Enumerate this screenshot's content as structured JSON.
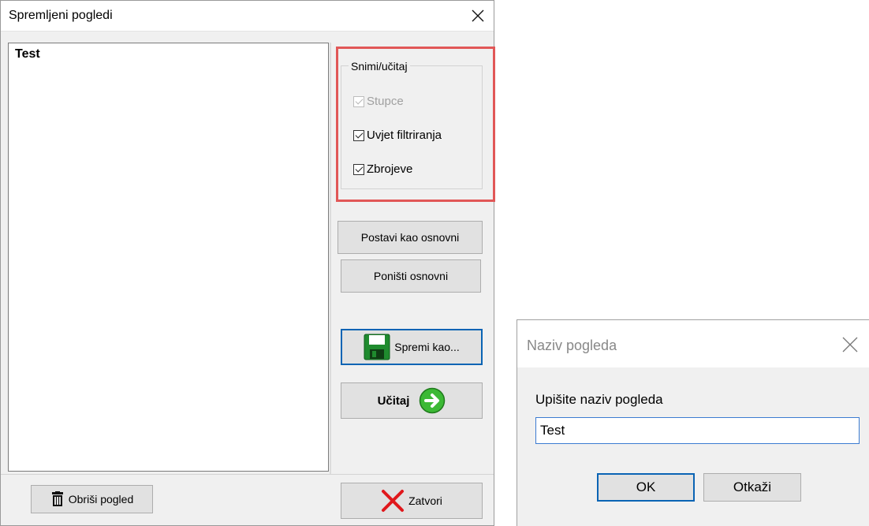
{
  "main_dialog": {
    "title": "Spremljeni pogledi",
    "close_symbol": "×",
    "views": [
      "Test"
    ],
    "group": {
      "label": "Snimi/učitaj",
      "checkboxes": [
        {
          "label": "Stupce",
          "checked": true,
          "disabled": true
        },
        {
          "label": "Uvjet filtriranja",
          "checked": true,
          "disabled": false
        },
        {
          "label": "Zbrojeve",
          "checked": true,
          "disabled": false
        }
      ]
    },
    "buttons": {
      "set_default": "Postavi kao osnovni",
      "reset_default": "Poništi osnovni",
      "save_as": "Spremi kao...",
      "load": "Učitaj",
      "delete_view": "Obriši pogled",
      "close": "Zatvori"
    },
    "icons": {
      "save": "floppy-disk-icon",
      "load": "green-arrow-right-icon",
      "delete": "trash-can-icon",
      "close": "red-x-icon"
    },
    "highlight_color": "#e15757"
  },
  "name_dialog": {
    "title": "Naziv pogleda",
    "prompt": "Upišite naziv pogleda",
    "input_value": "Test",
    "ok_label": "OK",
    "cancel_label": "Otkaži"
  }
}
